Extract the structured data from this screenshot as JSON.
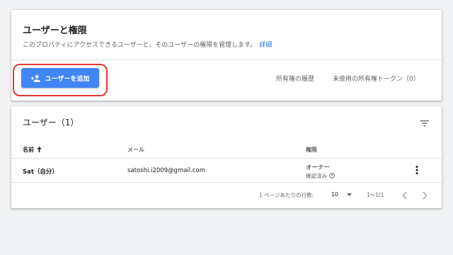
{
  "header": {
    "title": "ユーザーと権限",
    "description": "このプロパティにアクセスできるユーザーと、そのユーザーの権限を管理します。",
    "details_link": "詳細"
  },
  "toolbar": {
    "add_user_label": "ユーザーを追加",
    "history_label": "所有権の履歴",
    "tokens_label": "未使用の所有権トークン（0）"
  },
  "users_section": {
    "title": "ユーザー（1）",
    "columns": {
      "name": "名前",
      "email": "メール",
      "role": "権限"
    },
    "rows": [
      {
        "name": "Sat（自分）",
        "email": "satoshi.i2009@gmail.com",
        "role": "オーナー",
        "role_status": "確認済み"
      }
    ]
  },
  "pagination": {
    "rows_per_page_label": "1 ページあたりの行数:",
    "rows_per_page": "10",
    "range": "1〜1/1"
  },
  "colors": {
    "accent": "#4285f4",
    "highlight": "#e53935",
    "link": "#1a73e8"
  },
  "icons": {
    "add_user": "person-add-icon",
    "filter": "filter-icon",
    "sort": "arrow-up-icon",
    "help": "help-icon",
    "more": "more-vert-icon",
    "dropdown": "dropdown-arrow-icon",
    "prev": "chevron-left-icon",
    "next": "chevron-right-icon"
  }
}
